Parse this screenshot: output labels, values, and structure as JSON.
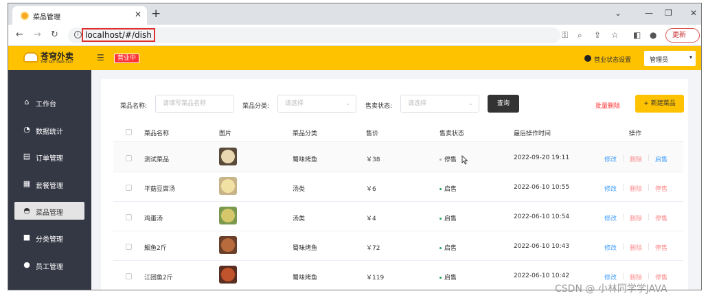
{
  "browser": {
    "tab_title": "菜品管理",
    "tab_close": "✕",
    "new_tab": "+",
    "url": "localhost/#/dish",
    "update_label": "更新"
  },
  "header": {
    "logo_text": "苍穹外卖",
    "logo_sub": "THE SKY TAKE-OUT",
    "status_badge": "营业中",
    "biz_settings": "营业状态设置",
    "user": "管理员"
  },
  "sidebar": {
    "items": [
      {
        "label": "工作台",
        "icon": "home-icon",
        "glyph": "⌂"
      },
      {
        "label": "数据统计",
        "icon": "chart-icon",
        "glyph": "◔"
      },
      {
        "label": "订单管理",
        "icon": "order-icon",
        "glyph": "▤"
      },
      {
        "label": "套餐管理",
        "icon": "combo-icon",
        "glyph": "▦"
      },
      {
        "label": "菜品管理",
        "icon": "dish-icon",
        "glyph": "◓"
      },
      {
        "label": "分类管理",
        "icon": "category-icon",
        "glyph": "■"
      },
      {
        "label": "员工管理",
        "icon": "staff-icon",
        "glyph": "●"
      }
    ],
    "active_index": 4
  },
  "filters": {
    "name_label": "菜品名称:",
    "name_placeholder": "请填写菜品名称",
    "category_label": "菜品分类:",
    "category_placeholder": "请选择",
    "status_label": "售卖状态:",
    "status_placeholder": "请选择",
    "query_label": "查询",
    "batch_delete_label": "批量删除",
    "new_dish_label": "+ 新建菜品"
  },
  "table": {
    "headers": [
      "菜品名称",
      "图片",
      "菜品分类",
      "售价",
      "售卖状态",
      "最后操作时间",
      "操作"
    ],
    "rows": [
      {
        "name": "测试菜品",
        "category": "蜀味烤鱼",
        "price": "￥38",
        "status": "停售",
        "time": "2022-09-20 19:11",
        "edit": "修改",
        "del": "删除",
        "toggle": "启售"
      },
      {
        "name": "平菇豆腐汤",
        "category": "汤类",
        "price": "￥6",
        "status": "启售",
        "time": "2022-06-10 10:55",
        "edit": "修改",
        "del": "删除",
        "toggle": "停售"
      },
      {
        "name": "鸡蛋汤",
        "category": "汤类",
        "price": "￥4",
        "status": "启售",
        "time": "2022-06-10 10:54",
        "edit": "修改",
        "del": "删除",
        "toggle": "停售"
      },
      {
        "name": "鮰鱼2斤",
        "category": "蜀味烤鱼",
        "price": "￥72",
        "status": "启售",
        "time": "2022-06-10 10:43",
        "edit": "修改",
        "del": "删除",
        "toggle": "停售"
      },
      {
        "name": "江团鱼2斤",
        "category": "蜀味烤鱼",
        "price": "￥119",
        "status": "启售",
        "time": "2022-06-10 10:42",
        "edit": "修改",
        "del": "删除",
        "toggle": "停售"
      }
    ]
  },
  "colors": {
    "brand": "#ffc200",
    "sidebar": "#343744",
    "on_sale": "#22a35b",
    "off_sale": "#aaaaaa",
    "edit": "#419eff",
    "danger": "#fd3333"
  },
  "watermark": "CSDN @ 小林同学学JAVA"
}
